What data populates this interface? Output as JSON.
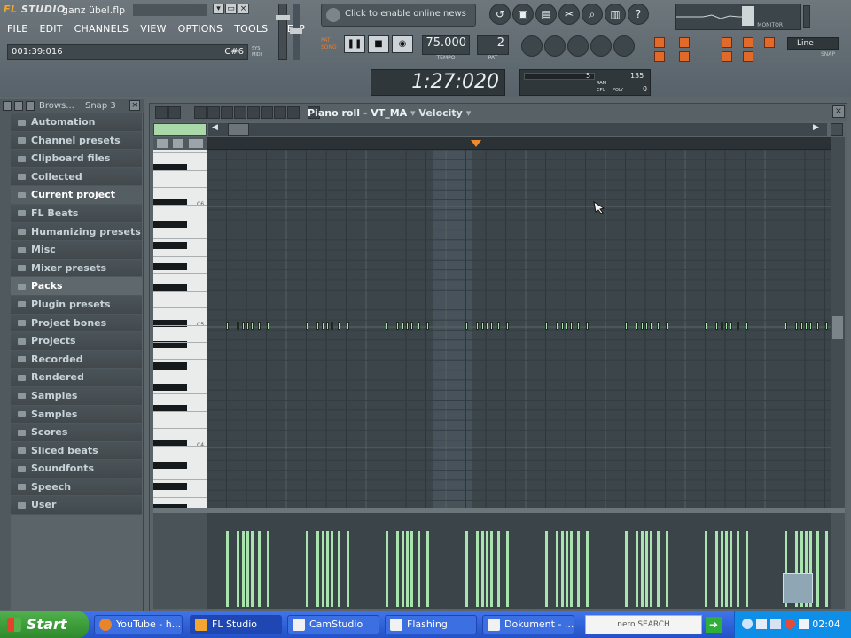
{
  "app": {
    "logo_fl": "FL",
    "logo_studio": "STUDIO",
    "project_title": "ganz übel.flp",
    "menu": [
      "FILE",
      "EDIT",
      "CHANNELS",
      "VIEW",
      "OPTIONS",
      "TOOLS",
      "HELP"
    ],
    "time_position": "001:39:016",
    "current_key": "C#6",
    "news_text": "Click to enable online news",
    "tempo": "75.000",
    "tempo_label": "TEMPO",
    "pattern": "2",
    "pattern_label": "PAT",
    "pat_song_labels": [
      "PAT",
      "SONG"
    ],
    "big_time": "1:27:020",
    "monitor_label": "MONITOR",
    "cpu": {
      "left": "5",
      "right": "135",
      "poly": "0"
    },
    "cpu_labels": [
      "RAM",
      "CPU",
      "POLY"
    ],
    "line_select": "Line",
    "snap_label": "SNAP"
  },
  "browser": {
    "title": "Brows...",
    "snap": "Snap 3",
    "items": [
      {
        "label": "Automation"
      },
      {
        "label": "Channel presets"
      },
      {
        "label": "Clipboard files"
      },
      {
        "label": "Collected"
      },
      {
        "label": "Current project"
      },
      {
        "label": "FL Beats"
      },
      {
        "label": "Humanizing presets"
      },
      {
        "label": "Misc"
      },
      {
        "label": "Mixer presets"
      },
      {
        "label": "Packs"
      },
      {
        "label": "Plugin presets"
      },
      {
        "label": "Project bones"
      },
      {
        "label": "Projects"
      },
      {
        "label": "Recorded"
      },
      {
        "label": "Rendered"
      },
      {
        "label": "Samples"
      },
      {
        "label": "Samples"
      },
      {
        "label": "Scores"
      },
      {
        "label": "Sliced beats"
      },
      {
        "label": "Soundfonts"
      },
      {
        "label": "Speech"
      },
      {
        "label": "User"
      }
    ]
  },
  "pianoroll": {
    "title": "Piano roll - VT_MA",
    "velocity": "Velocity",
    "key_labels": [
      "C6",
      "C5",
      "C4"
    ]
  },
  "taskbar": {
    "start": "Start",
    "tasks": [
      "YouTube - h...",
      "FL Studio",
      "CamStudio",
      "Flashing",
      "Dokument - ..."
    ],
    "nero": "nero SEARCH",
    "clock": "02:04"
  }
}
